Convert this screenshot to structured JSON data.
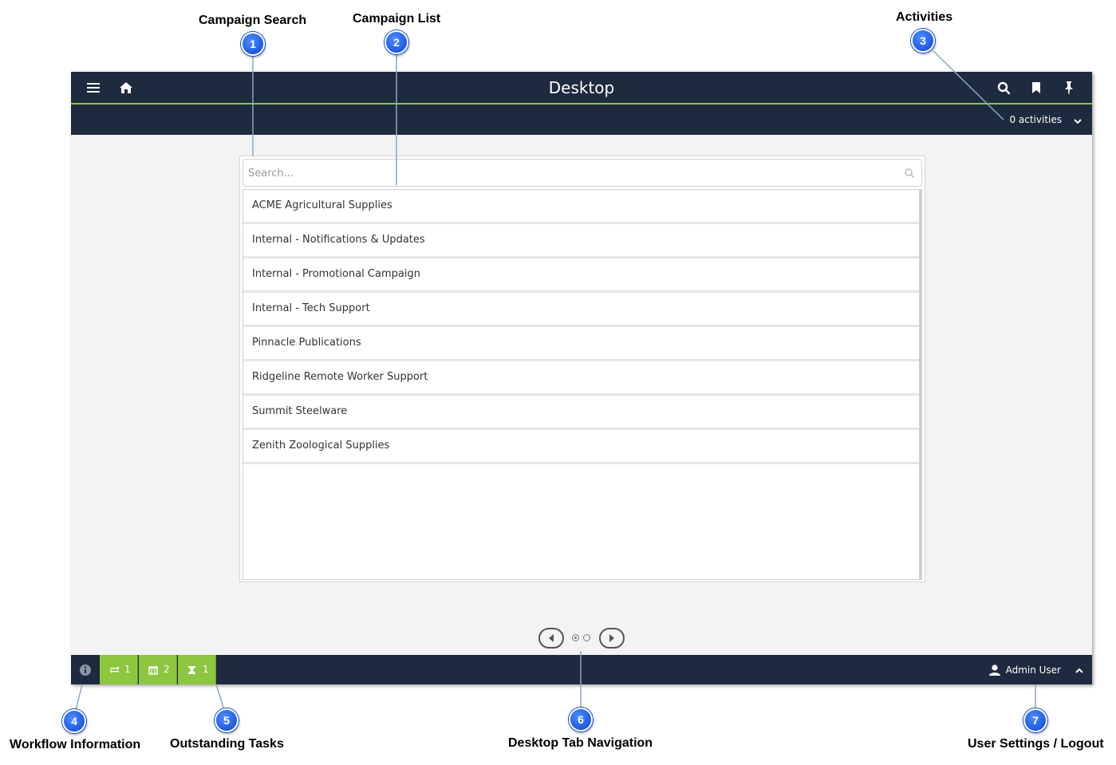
{
  "window": {
    "title": "Desktop",
    "activities": "0 activities"
  },
  "search": {
    "placeholder": "Search..."
  },
  "campaigns": [
    "ACME Agricultural Supplies",
    "Internal - Notifications & Updates",
    "Internal - Promotional Campaign",
    "Internal - Tech Support",
    "Pinnacle Publications",
    "Ridgeline Remote Worker Support",
    "Summit Steelware",
    "Zenith Zoological Supplies"
  ],
  "tasks": {
    "transfers": "1",
    "calendar": "2",
    "pending": "1"
  },
  "user": {
    "name": "Admin User"
  },
  "callouts": [
    {
      "number": "1",
      "label": "Campaign Search"
    },
    {
      "number": "2",
      "label": "Campaign List"
    },
    {
      "number": "3",
      "label": "Activities"
    },
    {
      "number": "4",
      "label": "Workflow Information"
    },
    {
      "number": "5",
      "label": "Outstanding Tasks"
    },
    {
      "number": "6",
      "label": "Desktop Tab Navigation"
    },
    {
      "number": "7",
      "label": "User Settings / Logout"
    }
  ],
  "colors": {
    "header": "#1e2a3d",
    "accent": "#8dc63f",
    "background": "#f3f3f3",
    "callout": "#1a5cf0"
  },
  "icons": [
    "menu-icon",
    "home-icon",
    "search-icon",
    "bookmark-icon",
    "pin-icon",
    "chevron-down-icon",
    "info-icon",
    "transfer-icon",
    "calendar-icon",
    "hourglass-icon",
    "user-icon",
    "chevron-up-icon",
    "arrow-left-icon",
    "arrow-right-icon"
  ]
}
